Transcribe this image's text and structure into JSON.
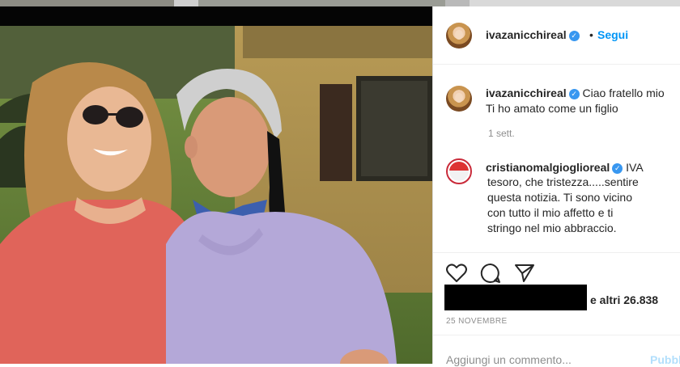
{
  "post": {
    "author": "ivazanicchireal",
    "separator": "•",
    "follow_label": "Segui",
    "likes_suffix": "e altri 26.838",
    "date": "25 NOVEMBRE",
    "add_comment_placeholder": "Aggiungi un commento...",
    "publish_label": "Pubblica"
  },
  "comments": [
    {
      "author": "ivazanicchireal",
      "line1": "Ciao fratello mio",
      "line2": "Ti ho amato come un figlio",
      "time": "1 sett."
    },
    {
      "author": "cristianomalgioglioreal",
      "line1": "IVA",
      "line2": "tesoro, che tristezza.....sentire",
      "line3": "questa notizia. Ti sono vicino",
      "line4": "con tutto il mio affetto e ti",
      "line5": "stringo nel mio abbraccio."
    }
  ],
  "icons": {
    "verified": "verified-badge-icon",
    "like": "heart-icon",
    "comment": "comment-bubble-icon",
    "share": "paper-plane-icon"
  },
  "colors": {
    "accent": "#0095f6",
    "verified": "#3897f0",
    "text": "#262626",
    "muted": "#8e8e8e"
  }
}
